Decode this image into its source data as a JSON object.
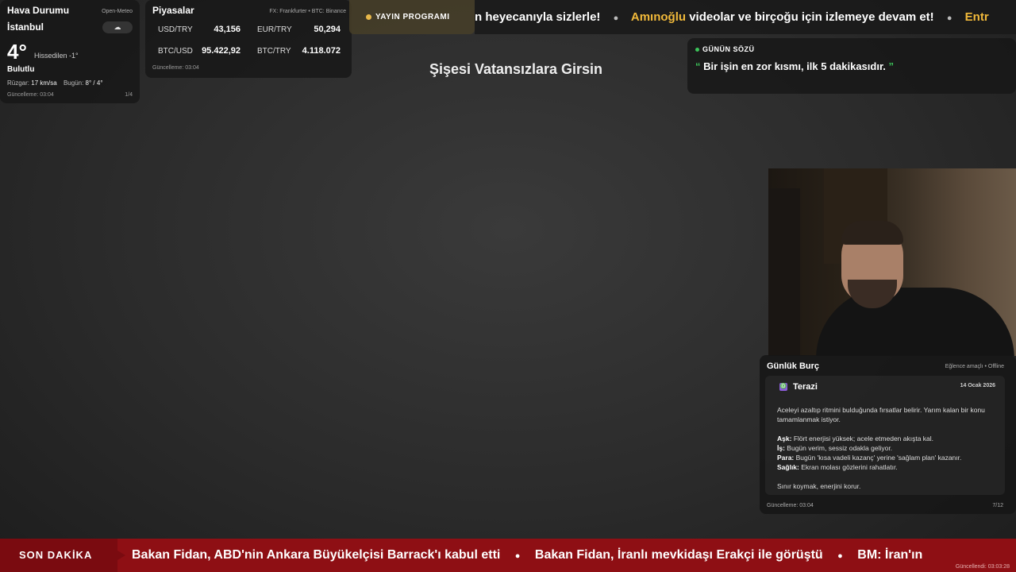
{
  "weather": {
    "title": "Hava Durumu",
    "source": "Open-Meteo",
    "city": "İstanbul",
    "icon": "☁",
    "temperature": "4°",
    "feels_like": "Hissedilen -1°",
    "condition": "Bulutlu",
    "wind_label": "Rüzgar:",
    "wind_value": "17 km/sa",
    "today_label": "Bugün:",
    "today_value": "8° / 4°",
    "updated": "Güncelleme: 03:04",
    "page": "1/4"
  },
  "markets": {
    "title": "Piyasalar",
    "source": "FX: Frankfurter • BTC: Binance",
    "items": [
      {
        "label": "USD/TRY",
        "value": "43,156"
      },
      {
        "label": "EUR/TRY",
        "value": "50,294"
      },
      {
        "label": "BTC/USD",
        "value": "95.422,92"
      },
      {
        "label": "BTC/TRY",
        "value": "4.118.072"
      }
    ],
    "updated": "Güncelleme: 03:04"
  },
  "schedule": {
    "label": "YAYIN PROGRAMI"
  },
  "top_ticker": {
    "part1": "n heyecanıyla sizlerle!",
    "highlight": "Amınoğlu",
    "part2": "videolar ve birçoğu için izlemeye devam et!",
    "part3": "Entr"
  },
  "center_title": "Şişesi Vatansızlara Girsin",
  "quote": {
    "header": "GÜNÜN SÖZÜ",
    "open": "“",
    "text": "Bir işin en zor kısmı, ilk 5 dakikasıdır.",
    "close": "”"
  },
  "horoscope": {
    "title": "Günlük Burç",
    "source": "Eğlence amaçlı • Offline",
    "sign_icon": "♎",
    "sign": "Terazi",
    "date": "14 Ocak 2026",
    "intro": "Aceleyi azaltıp ritmini bulduğunda fırsatlar belirir. Yarım kalan bir konu tamamlanmak istiyor.",
    "love_label": "Aşk:",
    "love": "Flört enerjisi yüksek; acele etmeden akışta kal.",
    "work_label": "İş:",
    "work": "Bugün verim, sessiz odakla geliyor.",
    "money_label": "Para:",
    "money": "Bugün 'kısa vadeli kazanç' yerine 'sağlam plan' kazanır.",
    "health_label": "Sağlık:",
    "health": "Ekran molası gözlerini rahatlatır.",
    "closing": "Sınır koymak, enerjini korur.",
    "updated": "Güncelleme: 03:04",
    "page": "7/12"
  },
  "breaking": {
    "label": "SON DAKİKA",
    "items": [
      "Bakan Fidan, ABD'nin Ankara Büyükelçisi Barrack'ı kabul etti",
      "Bakan Fidan, İranlı mevkidaşı Erakçi ile görüştü",
      "BM: İran'ın"
    ],
    "updated": "Güncellendi: 03:03:28"
  },
  "colors": {
    "accent": "#f1b93a",
    "quote_green": "#3cc45a",
    "breaking_red": "#8e0f14"
  }
}
